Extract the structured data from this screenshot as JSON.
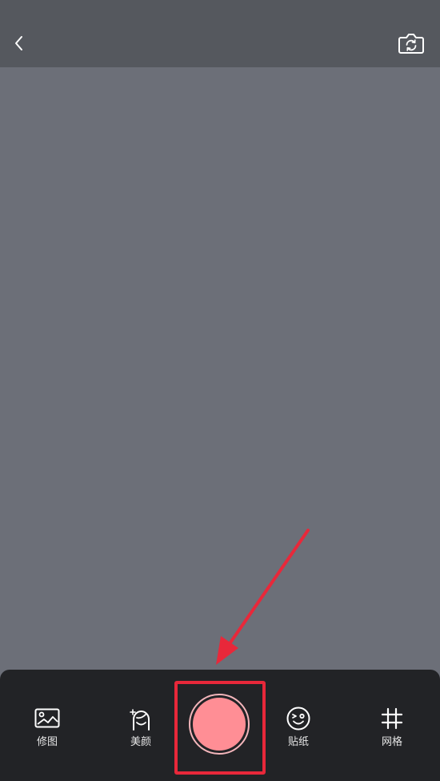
{
  "header": {
    "back_icon": "chevron-left-icon",
    "switch_camera_icon": "camera-switch-icon"
  },
  "toolbar": {
    "items": [
      {
        "label": "修图",
        "icon": "image-edit-icon"
      },
      {
        "label": "美颜",
        "icon": "beauty-face-icon"
      },
      {
        "label": "贴纸",
        "icon": "sticker-icon"
      },
      {
        "label": "网格",
        "icon": "grid-icon"
      }
    ],
    "shutter_icon": "shutter-button"
  },
  "colors": {
    "top_bar": "#55585e",
    "viewfinder": "#6c6f78",
    "bottom_bar": "#222326",
    "shutter_fill": "#ff8e95",
    "highlight": "#e8283a"
  }
}
